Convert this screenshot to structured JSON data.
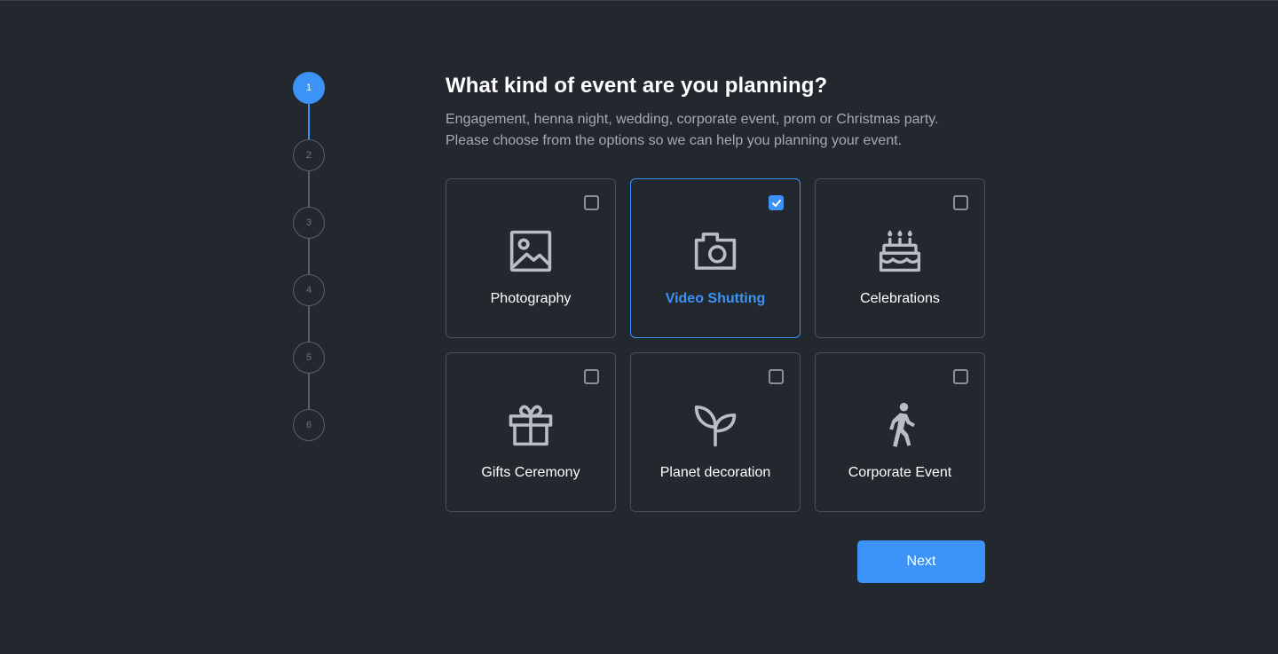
{
  "stepper": {
    "steps": [
      "1",
      "2",
      "3",
      "4",
      "5",
      "6"
    ],
    "active_step": 1
  },
  "heading": {
    "title": "What kind of event are you planning?",
    "subtitle_line1": "Engagement, henna night, wedding, corporate event, prom or Christmas party.",
    "subtitle_line2": "Please choose from the options so we can help you planning your event."
  },
  "options": [
    {
      "label": "Photography",
      "icon": "image-icon",
      "checked": false
    },
    {
      "label": "Video Shutting",
      "icon": "camera-icon",
      "checked": true
    },
    {
      "label": "Celebrations",
      "icon": "cake-icon",
      "checked": false
    },
    {
      "label": "Gifts Ceremony",
      "icon": "gift-icon",
      "checked": false
    },
    {
      "label": "Planet decoration",
      "icon": "sprout-icon",
      "checked": false
    },
    {
      "label": "Corporate Event",
      "icon": "walking-person-icon",
      "checked": false
    }
  ],
  "actions": {
    "next_label": "Next"
  },
  "colors": {
    "background": "#23282e",
    "accent": "#3b93f7",
    "card_border": "#4a5058",
    "icon_gray": "#b9bec4",
    "muted_text": "#a5abb2"
  }
}
